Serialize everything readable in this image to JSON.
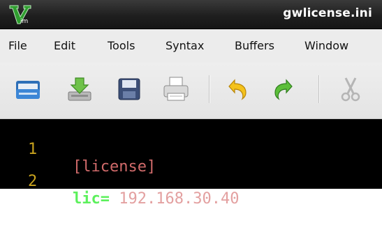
{
  "window": {
    "title": "gwlicense.ini"
  },
  "menubar": {
    "items": [
      "File",
      "Edit",
      "Tools",
      "Syntax",
      "Buffers",
      "Window"
    ]
  },
  "toolbar": {
    "buttons": [
      {
        "icon": "open-folder-icon"
      },
      {
        "icon": "save-download-icon"
      },
      {
        "icon": "save-disk-icon"
      },
      {
        "icon": "print-icon"
      },
      {
        "icon": "undo-icon"
      },
      {
        "icon": "redo-icon"
      },
      {
        "icon": "cut-scissors-icon"
      }
    ]
  },
  "editor": {
    "lines": [
      {
        "number": "1",
        "section": "[license]"
      },
      {
        "number": "2",
        "key": "lic",
        "eq": "=",
        "quote_open": "\"",
        "value": "192.168.30.40",
        "quote_close": "\""
      }
    ]
  },
  "colors": {
    "line_number": "#c8a31e",
    "section": "#d06a6a",
    "key": "#5cf05c",
    "string": "#e3a0a0"
  }
}
